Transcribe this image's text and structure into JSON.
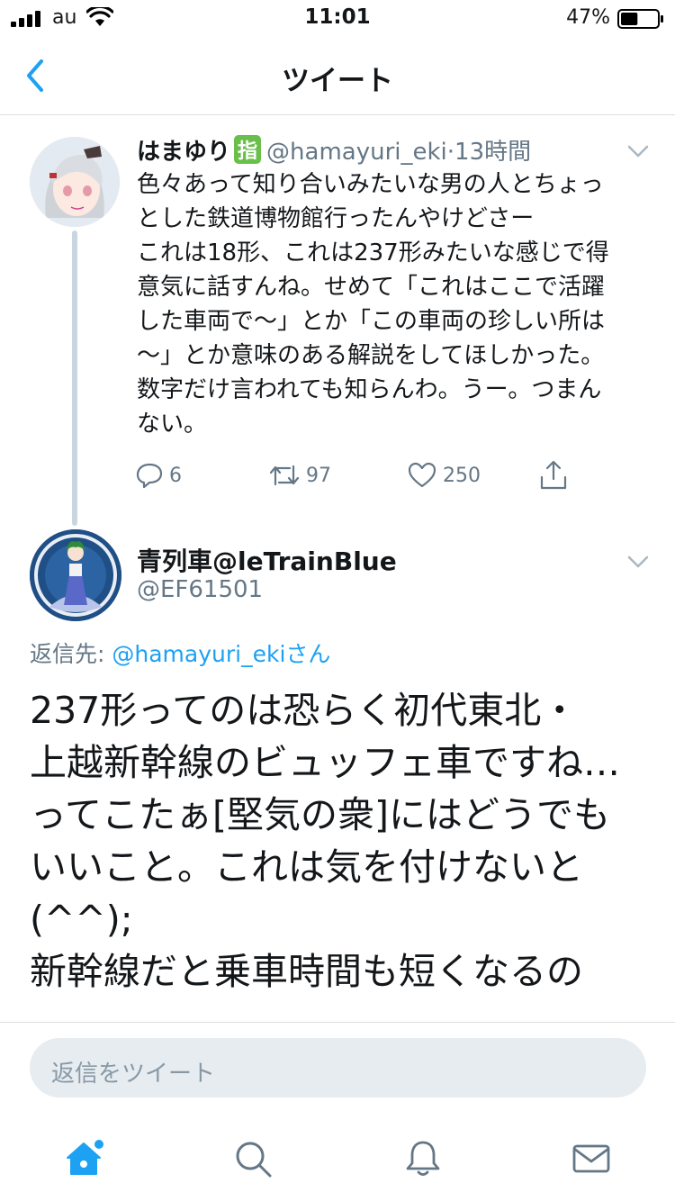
{
  "status_bar": {
    "carrier": "au",
    "time": "11:01",
    "battery_percent": "47%",
    "battery_level": 0.47
  },
  "nav": {
    "title": "ツイート"
  },
  "tweet1": {
    "name": "はまゆり",
    "badge": "指",
    "handle": "@hamayuri_eki",
    "separator": "·",
    "time": "13時間",
    "body": "色々あって知り合いみたいな男の人とちょっ\nとした鉄道博物館行ったんやけどさー\nこれは18形、これは237形みたいな感じで得\n意気に話すんね。せめて「これはここで活躍\nした車両で〜」とか「この車両の珍しい所は\n〜」とか意味のある解説をしてほしかった。\n数字だけ言われても知らんわ。うー。つまん\nない。",
    "replies": "6",
    "retweets": "97",
    "likes": "250"
  },
  "tweet2": {
    "name": "青列車@leTrainBlue",
    "handle": "@EF61501",
    "reply_label": "返信先:",
    "reply_mention": "@hamayuri_ekiさん",
    "body": "237形ってのは恐らく初代東北・\n上越新幹線のビュッフェ車ですね…\nってこたぁ[堅気の衆]にはどうでも\nいいこと。これは気を付けないと\n(^^);\n新幹線だと乗車時間も短くなるの"
  },
  "composer": {
    "placeholder": "返信をツイート"
  },
  "tabs": [
    {
      "icon": "home-icon"
    },
    {
      "icon": "search-icon"
    },
    {
      "icon": "bell-icon"
    },
    {
      "icon": "mail-icon"
    }
  ],
  "colors": {
    "accent": "#1da1f2",
    "secondary_text": "#657786",
    "badge": "#6abf4b"
  }
}
